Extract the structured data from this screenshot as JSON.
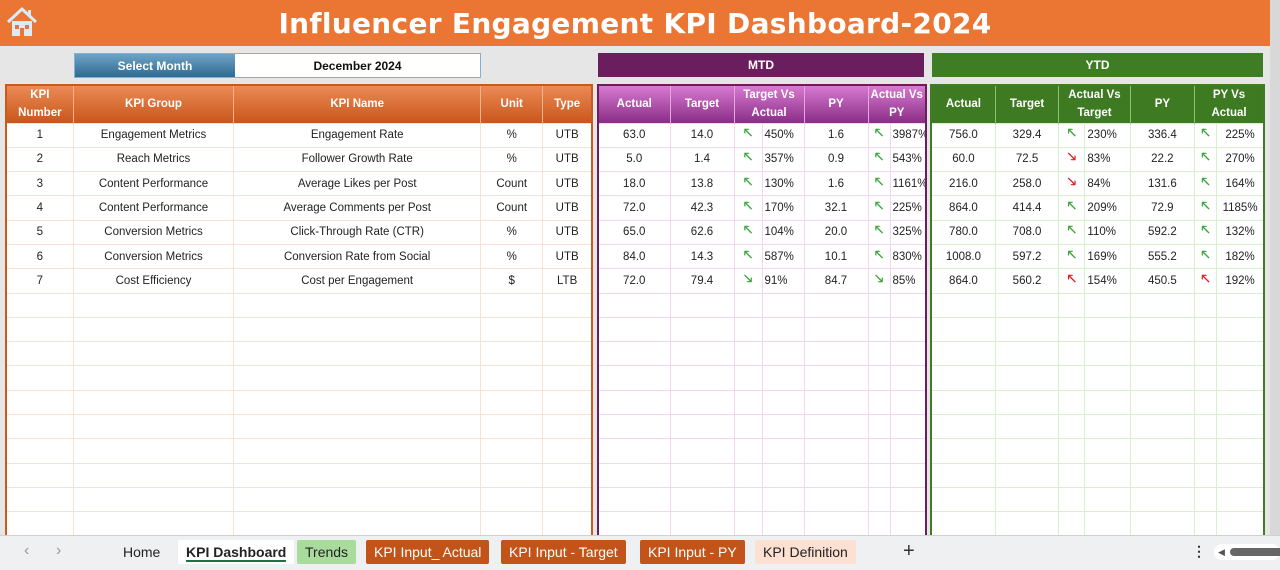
{
  "title": "Influencer Engagement KPI Dashboard-2024",
  "month_selector": {
    "label": "Select Month",
    "value": "December 2024"
  },
  "sections": {
    "mtd": "MTD",
    "ytd": "YTD"
  },
  "main_headers": [
    "KPI Number",
    "KPI Group",
    "KPI Name",
    "Unit",
    "Type"
  ],
  "mtd_headers": [
    "Actual",
    "Target",
    "Target Vs Actual",
    "PY",
    "Actual Vs PY"
  ],
  "ytd_headers": [
    "Actual",
    "Target",
    "Actual Vs Target",
    "PY",
    "PY Vs Actual"
  ],
  "rows": [
    {
      "num": "1",
      "group": "Engagement Metrics",
      "name": "Engagement Rate",
      "unit": "%",
      "type": "UTB",
      "mtd": {
        "actual": "63.0",
        "target": "14.0",
        "tva_icon": "up",
        "tva": "450%",
        "py": "1.6",
        "avp_icon": "up",
        "avp": "3987%"
      },
      "ytd": {
        "actual": "756.0",
        "target": "329.4",
        "avt_icon": "up",
        "avt": "230%",
        "py": "336.4",
        "pva_icon": "up",
        "pva": "225%"
      }
    },
    {
      "num": "2",
      "group": "Reach Metrics",
      "name": "Follower Growth Rate",
      "unit": "%",
      "type": "UTB",
      "mtd": {
        "actual": "5.0",
        "target": "1.4",
        "tva_icon": "up",
        "tva": "357%",
        "py": "0.9",
        "avp_icon": "up",
        "avp": "543%"
      },
      "ytd": {
        "actual": "60.0",
        "target": "72.5",
        "avt_icon": "down-bad",
        "avt": "83%",
        "py": "22.2",
        "pva_icon": "up",
        "pva": "270%"
      }
    },
    {
      "num": "3",
      "group": "Content Performance",
      "name": "Average Likes per Post",
      "unit": "Count",
      "type": "UTB",
      "mtd": {
        "actual": "18.0",
        "target": "13.8",
        "tva_icon": "up",
        "tva": "130%",
        "py": "1.6",
        "avp_icon": "up",
        "avp": "1161%"
      },
      "ytd": {
        "actual": "216.0",
        "target": "258.0",
        "avt_icon": "down-bad",
        "avt": "84%",
        "py": "131.6",
        "pva_icon": "up",
        "pva": "164%"
      }
    },
    {
      "num": "4",
      "group": "Content Performance",
      "name": "Average Comments per Post",
      "unit": "Count",
      "type": "UTB",
      "mtd": {
        "actual": "72.0",
        "target": "42.3",
        "tva_icon": "up",
        "tva": "170%",
        "py": "32.1",
        "avp_icon": "up",
        "avp": "225%"
      },
      "ytd": {
        "actual": "864.0",
        "target": "414.4",
        "avt_icon": "up",
        "avt": "209%",
        "py": "72.9",
        "pva_icon": "up",
        "pva": "1185%"
      }
    },
    {
      "num": "5",
      "group": "Conversion Metrics",
      "name": "Click-Through Rate (CTR)",
      "unit": "%",
      "type": "UTB",
      "mtd": {
        "actual": "65.0",
        "target": "62.6",
        "tva_icon": "up",
        "tva": "104%",
        "py": "20.0",
        "avp_icon": "up",
        "avp": "325%"
      },
      "ytd": {
        "actual": "780.0",
        "target": "708.0",
        "avt_icon": "up",
        "avt": "110%",
        "py": "592.2",
        "pva_icon": "up",
        "pva": "132%"
      }
    },
    {
      "num": "6",
      "group": "Conversion Metrics",
      "name": "Conversion Rate from Social",
      "unit": "%",
      "type": "UTB",
      "mtd": {
        "actual": "84.0",
        "target": "14.3",
        "tva_icon": "up",
        "tva": "587%",
        "py": "10.1",
        "avp_icon": "up",
        "avp": "830%"
      },
      "ytd": {
        "actual": "1008.0",
        "target": "597.2",
        "avt_icon": "up",
        "avt": "169%",
        "py": "555.2",
        "pva_icon": "up",
        "pva": "182%"
      }
    },
    {
      "num": "7",
      "group": "Cost Efficiency",
      "name": "Cost per Engagement",
      "unit": "$",
      "type": "LTB",
      "mtd": {
        "actual": "72.0",
        "target": "79.4",
        "tva_icon": "down-good",
        "tva": "91%",
        "py": "84.7",
        "avp_icon": "down-good",
        "avp": "85%"
      },
      "ytd": {
        "actual": "864.0",
        "target": "560.2",
        "avt_icon": "up-bad",
        "avt": "154%",
        "py": "450.5",
        "pva_icon": "up-bad",
        "pva": "192%"
      }
    }
  ],
  "empty_rows": 10,
  "icons": {
    "up": {
      "glyph": "🡔",
      "name": "arrow-up-left-green-icon"
    },
    "down-good": {
      "glyph": "🡖",
      "name": "arrow-down-right-green-icon"
    },
    "down-bad": {
      "glyph": "🡖",
      "name": "arrow-down-right-red-icon"
    },
    "up-bad": {
      "glyph": "🡔",
      "name": "arrow-up-left-red-icon"
    }
  },
  "colors": {
    "title_bg": "#eb7533",
    "mtd": "#6b1e5e",
    "ytd": "#3e7d23",
    "good": "#3aa43a",
    "bad": "#e01b1b"
  },
  "sheet_tabs": [
    {
      "label": "Home",
      "bg": "transparent",
      "color": "#222",
      "active": false
    },
    {
      "label": "KPI Dashboard",
      "bg": "#ffffff",
      "color": "#222",
      "active": true
    },
    {
      "label": "Trends",
      "bg": "#a9dc9c",
      "color": "#222",
      "active": false
    },
    {
      "label": "KPI Input_ Actual",
      "bg": "#c2541a",
      "color": "#ffffff",
      "active": false
    },
    {
      "label": "KPI Input - Target",
      "bg": "#c2541a",
      "color": "#ffffff",
      "active": false
    },
    {
      "label": "KPI Input - PY",
      "bg": "#c2541a",
      "color": "#ffffff",
      "active": false
    },
    {
      "label": "KPI Definition",
      "bg": "#fce0d2",
      "color": "#222",
      "active": false
    }
  ],
  "tabbar": {
    "prev": "‹",
    "next": "›",
    "add": "+",
    "more": "⋮"
  }
}
